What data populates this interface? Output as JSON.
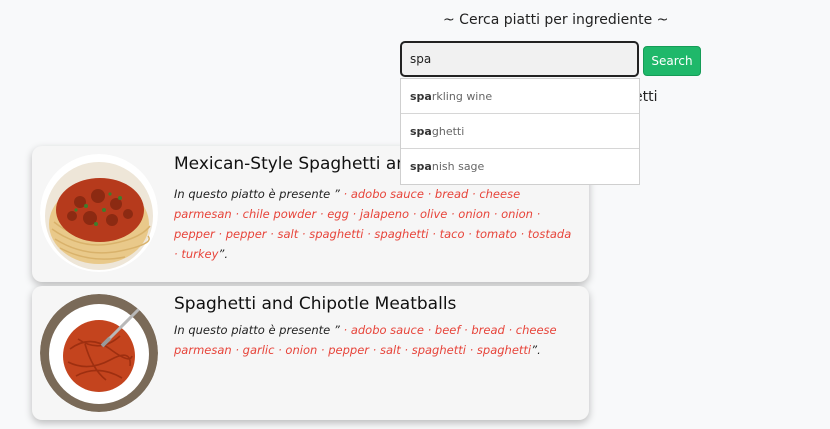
{
  "search": {
    "title": "~ Cerca piatti per ingrediente ~",
    "value": "spa",
    "button_label": "Search",
    "behind_text": "etti",
    "suggestions": [
      {
        "bold": "spa",
        "rest": "rkling wine"
      },
      {
        "bold": "spa",
        "rest": "ghetti"
      },
      {
        "bold": "spa",
        "rest": "nish sage"
      }
    ]
  },
  "recipes": [
    {
      "title": "Mexican-Style Spaghetti and Meatballs",
      "prefix": "In questo piatto è presente ”",
      "ingredients": [
        "adobo sauce",
        "bread",
        "cheese parmesan",
        "chile powder",
        "egg",
        "jalapeno",
        "olive",
        "onion",
        "onion",
        "pepper",
        "pepper",
        "salt",
        "spaghetti",
        "spaghetti",
        "taco",
        "tomato",
        "tostada",
        "turkey"
      ],
      "suffix": "”."
    },
    {
      "title": "Spaghetti and Chipotle Meatballs",
      "prefix": "In questo piatto è presente ”",
      "ingredients": [
        "adobo sauce",
        "beef",
        "bread",
        "cheese parmesan",
        "garlic",
        "onion",
        "pepper",
        "salt",
        "spaghetti",
        "spaghetti"
      ],
      "suffix": "”."
    }
  ],
  "colors": {
    "accent": "#1fb86a",
    "ingredient": "#e7443a",
    "background": "#f8f9fa"
  }
}
